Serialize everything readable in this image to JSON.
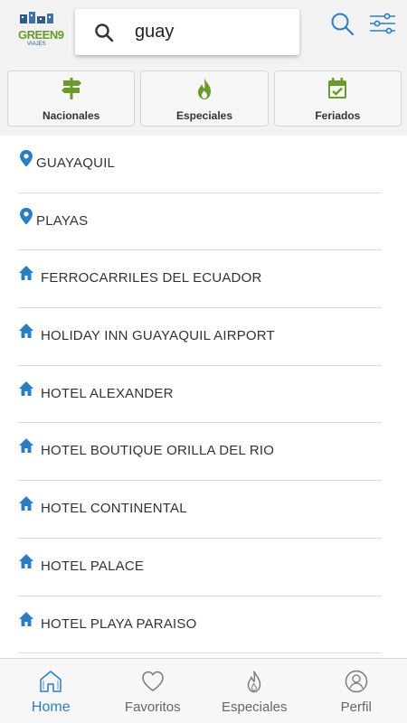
{
  "colors": {
    "accent": "#2b7ec1",
    "green": "#6a9a2c",
    "text": "#333333",
    "muted": "#666666"
  },
  "header": {
    "logo_text": "GREEN9",
    "logo_sub": "VIAJES",
    "search": {
      "value": "guay",
      "icon": "search-icon"
    },
    "actions": [
      {
        "icon": "search-icon"
      },
      {
        "icon": "filter-sliders-icon"
      }
    ]
  },
  "categories": [
    {
      "label": "Nacionales",
      "icon": "signpost-icon"
    },
    {
      "label": "Especiales",
      "icon": "flame-icon"
    },
    {
      "label": "Feriados",
      "icon": "calendar-check-icon"
    }
  ],
  "results": [
    {
      "label": "GUAYAQUIL",
      "type": "place",
      "icon": "location-pin-icon"
    },
    {
      "label": "PLAYAS",
      "type": "place",
      "icon": "location-pin-icon"
    },
    {
      "label": "FERROCARRILES DEL ECUADOR",
      "type": "hotel",
      "icon": "home-icon"
    },
    {
      "label": "HOLIDAY INN GUAYAQUIL AIRPORT",
      "type": "hotel",
      "icon": "home-icon"
    },
    {
      "label": "HOTEL ALEXANDER",
      "type": "hotel",
      "icon": "home-icon"
    },
    {
      "label": "HOTEL BOUTIQUE ORILLA DEL RIO",
      "type": "hotel",
      "icon": "home-icon"
    },
    {
      "label": "HOTEL CONTINENTAL",
      "type": "hotel",
      "icon": "home-icon"
    },
    {
      "label": "HOTEL PALACE",
      "type": "hotel",
      "icon": "home-icon"
    },
    {
      "label": "HOTEL PLAYA PARAISO",
      "type": "hotel",
      "icon": "home-icon"
    }
  ],
  "nav": [
    {
      "label": "Home",
      "icon": "home-outline-icon",
      "active": true
    },
    {
      "label": "Favoritos",
      "icon": "heart-icon",
      "active": false
    },
    {
      "label": "Especiales",
      "icon": "flame-outline-icon",
      "active": false
    },
    {
      "label": "Perfil",
      "icon": "user-icon",
      "active": false
    }
  ]
}
